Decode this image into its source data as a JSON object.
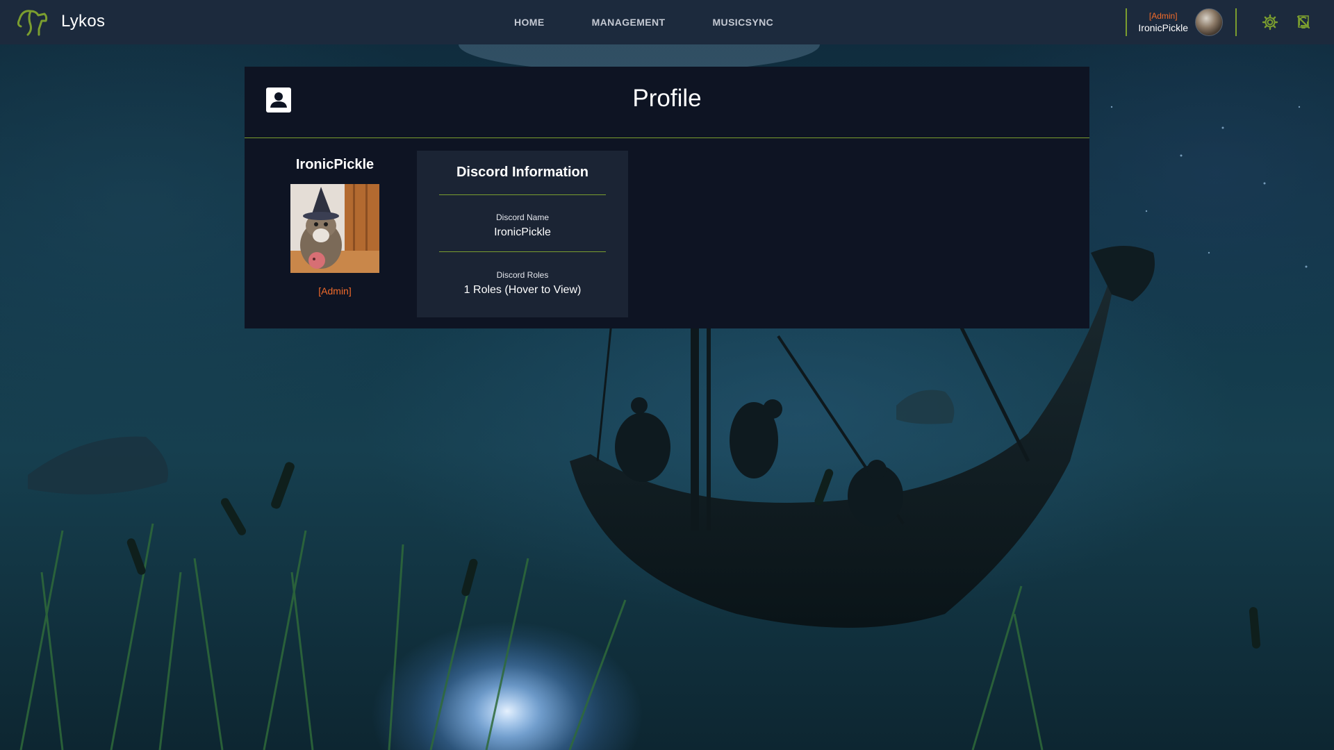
{
  "app": {
    "name": "Lykos"
  },
  "nav": {
    "links": [
      {
        "label": "HOME"
      },
      {
        "label": "MANAGEMENT"
      },
      {
        "label": "MUSICSYNC"
      }
    ]
  },
  "user": {
    "role": "[Admin]",
    "name": "IronicPickle"
  },
  "icons": {
    "settings": "gear-icon",
    "notifications": "notifications-off-icon",
    "profile": "account-box-icon"
  },
  "colors": {
    "accent": "#7b9e2f",
    "role": "#f26b2a",
    "navbar": "#1c2a3d",
    "card": "#0e1423",
    "info_card": "#1b2434"
  },
  "page": {
    "title": "Profile"
  },
  "profile": {
    "name": "IronicPickle",
    "role": "[Admin]"
  },
  "discord": {
    "title": "Discord Information",
    "name_label": "Discord Name",
    "name_value": "IronicPickle",
    "roles_label": "Discord Roles",
    "roles_value": "1 Roles (Hover to View)"
  }
}
